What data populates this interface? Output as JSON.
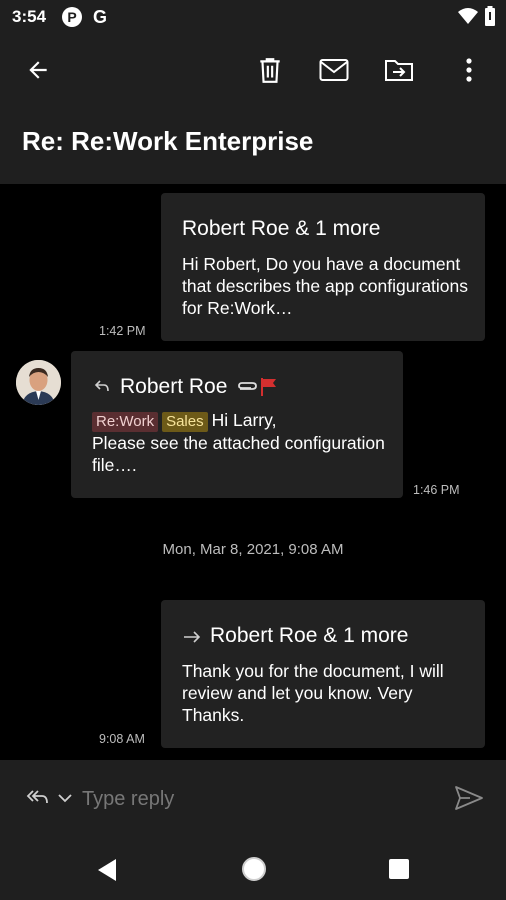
{
  "status": {
    "time": "3:54",
    "app_icons": [
      "P",
      "G"
    ]
  },
  "toolbar": {
    "back_icon": "arrow-left-icon",
    "delete_icon": "trash-icon",
    "mark_unread_icon": "envelope-icon",
    "move_icon": "folder-move-icon",
    "more_icon": "more-vert-icon"
  },
  "thread": {
    "title": "Re: Re:Work Enterprise",
    "messages": [
      {
        "sender": "Robert Roe & 1 more",
        "preview": "Hi Robert, Do you have a document that describes the app configurations for Re:Work…",
        "time": "1:42 PM"
      },
      {
        "sender": "Robert Roe",
        "tags": [
          "Re:Work",
          "Sales"
        ],
        "preview_first": "Hi Larry,",
        "preview_rest": "Please see the attached configuration file….",
        "time": "1:46 PM",
        "colors": {
          "flag": "#d32f2f"
        }
      },
      {
        "sender": "Robert Roe & 1 more",
        "preview": "Thank you for the document, I will review and let you know. Very Thanks.",
        "time": "9:08 AM"
      }
    ],
    "date_separator": "Mon, Mar 8, 2021, 9:08 AM"
  },
  "reply": {
    "placeholder": "Type reply"
  }
}
